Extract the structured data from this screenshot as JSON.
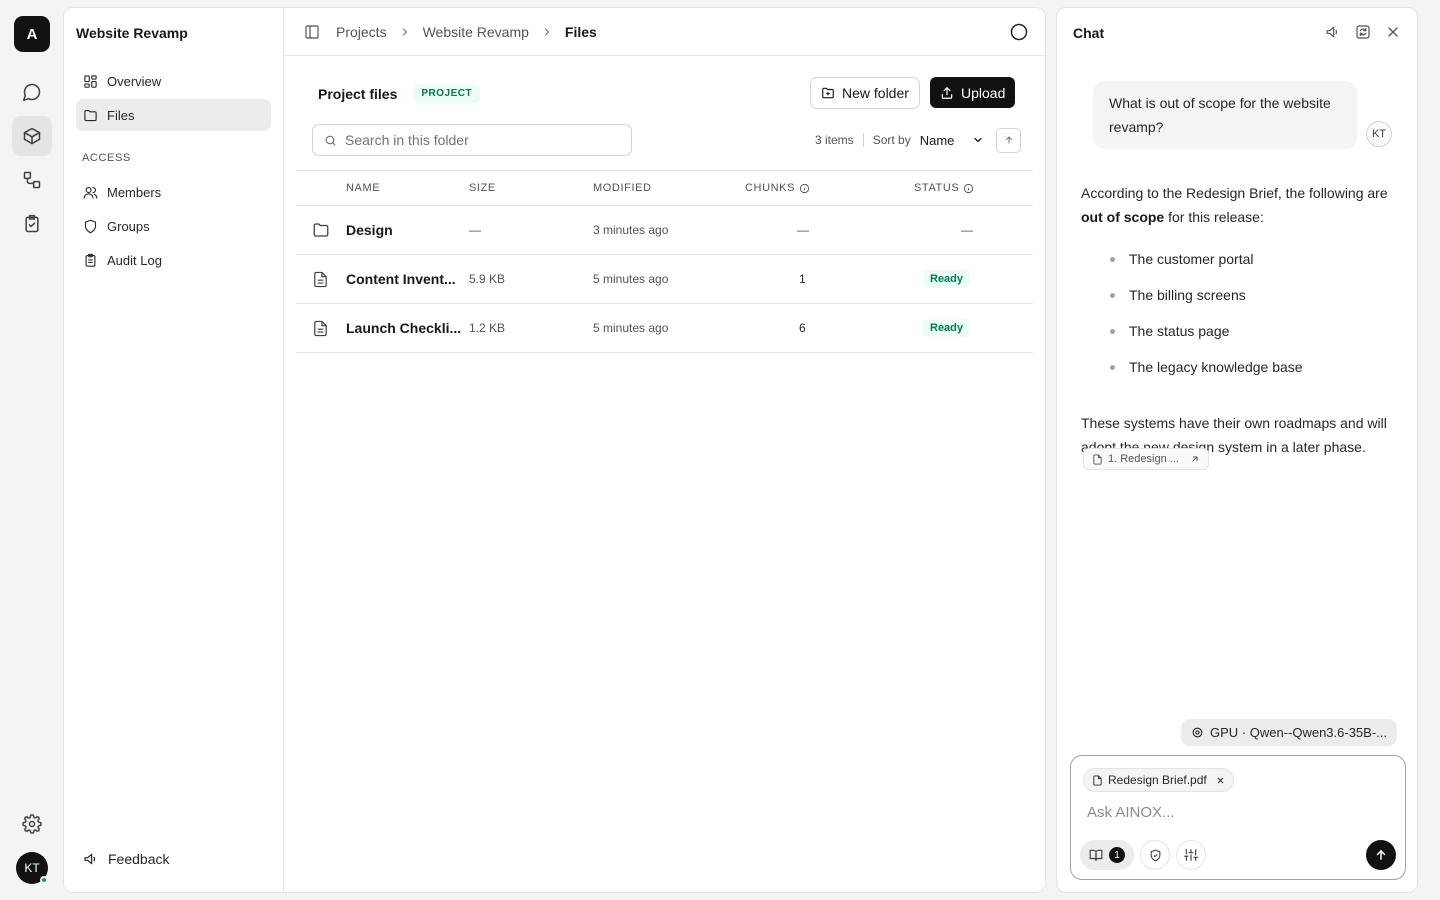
{
  "rail": {
    "workspace_initial": "A",
    "avatar_initials": "KT"
  },
  "sidebar": {
    "project_title": "Website Revamp",
    "items": [
      {
        "label": "Overview"
      },
      {
        "label": "Files"
      }
    ],
    "access_heading": "ACCESS",
    "access_items": [
      {
        "label": "Members"
      },
      {
        "label": "Groups"
      },
      {
        "label": "Audit Log"
      }
    ],
    "feedback_label": "Feedback"
  },
  "breadcrumb": {
    "items": [
      "Projects",
      "Website Revamp"
    ],
    "current": "Files"
  },
  "files_header": {
    "title": "Project files",
    "badge": "PROJECT",
    "new_folder_label": "New folder",
    "upload_label": "Upload"
  },
  "search": {
    "placeholder": "Search in this folder"
  },
  "list_controls": {
    "item_count": "3 items",
    "sort_by_label": "Sort by",
    "sort_value": "Name"
  },
  "table": {
    "columns": {
      "name": "NAME",
      "size": "SIZE",
      "modified": "MODIFIED",
      "chunks": "CHUNKS",
      "status": "STATUS"
    },
    "rows": [
      {
        "type": "folder",
        "name": "Design",
        "size": "—",
        "modified": "3 minutes ago",
        "chunks": "—",
        "status": "—"
      },
      {
        "type": "file",
        "name": "Content Invent...",
        "size": "5.9 KB",
        "modified": "5 minutes ago",
        "chunks": "1",
        "status": "Ready"
      },
      {
        "type": "file",
        "name": "Launch Checkli...",
        "size": "1.2 KB",
        "modified": "5 minutes ago",
        "chunks": "6",
        "status": "Ready"
      }
    ]
  },
  "chat": {
    "title": "Chat",
    "user_message": "What is out of scope for the website revamp?",
    "user_initials": "KT",
    "answer_intro_before": "According to the Redesign Brief, the following are ",
    "answer_intro_bold": "out of scope",
    "answer_intro_after": " for this release:",
    "answer_items": [
      "The customer portal",
      "The billing screens",
      "The status page",
      "The legacy knowledge base"
    ],
    "answer_outro": "These systems have their own roadmaps and will adopt the new design system in a later phase.",
    "citation": "1. Redesign ...",
    "model": "GPU · Qwen--Qwen3.6-35B-...",
    "attachment": "Redesign Brief.pdf",
    "input_placeholder": "Ask AINOX...",
    "sources_count": "1"
  },
  "colors": {
    "accent_dark": "#111113",
    "ready_bg": "#ecfdf5",
    "ready_text": "#047857"
  }
}
